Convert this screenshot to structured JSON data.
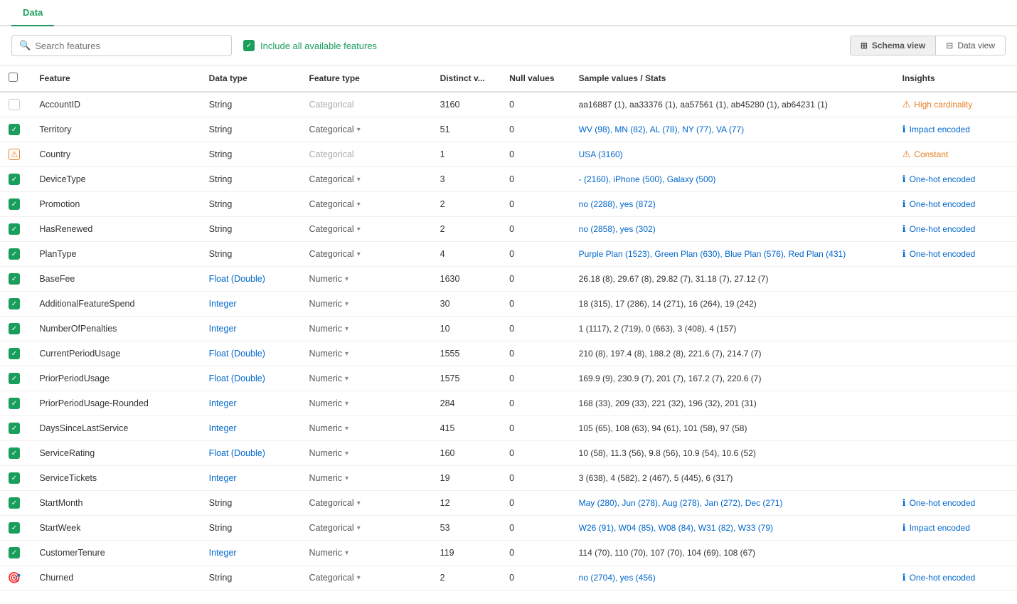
{
  "tabs": [
    {
      "label": "Data",
      "active": true
    }
  ],
  "toolbar": {
    "search_placeholder": "Search features",
    "include_label": "Include all available features",
    "schema_view_label": "Schema view",
    "data_view_label": "Data view"
  },
  "table": {
    "headers": [
      "",
      "Feature",
      "Data type",
      "Feature type",
      "Distinct v...",
      "Null values",
      "Sample values / Stats",
      "Insights"
    ],
    "rows": [
      {
        "check": "unchecked",
        "feature": "AccountID",
        "data_type": "String",
        "feature_type": "Categorical",
        "feature_type_muted": true,
        "distinct": "3160",
        "null": "0",
        "sample": "aa16887 (1), aa33376 (1), aa57561 (1), ab45280 (1), ab64231 (1)",
        "sample_type": "plain",
        "insight": "High cardinality",
        "insight_type": "warning"
      },
      {
        "check": "checked",
        "feature": "Territory",
        "data_type": "String",
        "feature_type": "Categorical",
        "has_chevron": true,
        "distinct": "51",
        "null": "0",
        "sample": "WV (98), MN (82), AL (78), NY (77), VA (77)",
        "sample_type": "link",
        "insight": "Impact encoded",
        "insight_type": "info"
      },
      {
        "check": "warning",
        "feature": "Country",
        "data_type": "String",
        "feature_type": "Categorical",
        "feature_type_muted": true,
        "distinct": "1",
        "null": "0",
        "sample": "USA (3160)",
        "sample_type": "link",
        "insight": "Constant",
        "insight_type": "warning"
      },
      {
        "check": "checked",
        "feature": "DeviceType",
        "data_type": "String",
        "feature_type": "Categorical",
        "has_chevron": true,
        "distinct": "3",
        "null": "0",
        "sample": "- (2160), iPhone (500), Galaxy (500)",
        "sample_type": "link",
        "insight": "One-hot encoded",
        "insight_type": "info"
      },
      {
        "check": "checked",
        "feature": "Promotion",
        "data_type": "String",
        "feature_type": "Categorical",
        "has_chevron": true,
        "distinct": "2",
        "null": "0",
        "sample": "no (2288), yes (872)",
        "sample_type": "link",
        "insight": "One-hot encoded",
        "insight_type": "info"
      },
      {
        "check": "checked",
        "feature": "HasRenewed",
        "data_type": "String",
        "feature_type": "Categorical",
        "has_chevron": true,
        "distinct": "2",
        "null": "0",
        "sample": "no (2858), yes (302)",
        "sample_type": "link",
        "insight": "One-hot encoded",
        "insight_type": "info"
      },
      {
        "check": "checked",
        "feature": "PlanType",
        "data_type": "String",
        "feature_type": "Categorical",
        "has_chevron": true,
        "distinct": "4",
        "null": "0",
        "sample": "Purple Plan (1523), Green Plan (630), Blue Plan (576), Red Plan (431)",
        "sample_type": "link",
        "insight": "One-hot encoded",
        "insight_type": "info"
      },
      {
        "check": "checked",
        "feature": "BaseFee",
        "data_type": "Float (Double)",
        "feature_type": "Numeric",
        "has_chevron": true,
        "distinct": "1630",
        "null": "0",
        "sample": "26.18 (8), 29.67 (8), 29.82 (7), 31.18 (7), 27.12 (7)",
        "sample_type": "plain",
        "insight": "",
        "insight_type": ""
      },
      {
        "check": "checked",
        "feature": "AdditionalFeatureSpend",
        "data_type": "Integer",
        "feature_type": "Numeric",
        "has_chevron": true,
        "distinct": "30",
        "null": "0",
        "sample": "18 (315), 17 (286), 14 (271), 16 (264), 19 (242)",
        "sample_type": "plain",
        "insight": "",
        "insight_type": ""
      },
      {
        "check": "checked",
        "feature": "NumberOfPenalties",
        "data_type": "Integer",
        "feature_type": "Numeric",
        "has_chevron": true,
        "distinct": "10",
        "null": "0",
        "sample": "1 (1117), 2 (719), 0 (663), 3 (408), 4 (157)",
        "sample_type": "plain",
        "insight": "",
        "insight_type": ""
      },
      {
        "check": "checked",
        "feature": "CurrentPeriodUsage",
        "data_type": "Float (Double)",
        "feature_type": "Numeric",
        "has_chevron": true,
        "distinct": "1555",
        "null": "0",
        "sample": "210 (8), 197.4 (8), 188.2 (8), 221.6 (7), 214.7 (7)",
        "sample_type": "plain",
        "insight": "",
        "insight_type": ""
      },
      {
        "check": "checked",
        "feature": "PriorPeriodUsage",
        "data_type": "Float (Double)",
        "feature_type": "Numeric",
        "has_chevron": true,
        "distinct": "1575",
        "null": "0",
        "sample": "169.9 (9), 230.9 (7), 201 (7), 167.2 (7), 220.6 (7)",
        "sample_type": "plain",
        "insight": "",
        "insight_type": ""
      },
      {
        "check": "checked",
        "feature": "PriorPeriodUsage-Rounded",
        "data_type": "Integer",
        "feature_type": "Numeric",
        "has_chevron": true,
        "distinct": "284",
        "null": "0",
        "sample": "168 (33), 209 (33), 221 (32), 196 (32), 201 (31)",
        "sample_type": "plain",
        "insight": "",
        "insight_type": ""
      },
      {
        "check": "checked",
        "feature": "DaysSinceLastService",
        "data_type": "Integer",
        "feature_type": "Numeric",
        "has_chevron": true,
        "distinct": "415",
        "null": "0",
        "sample": "105 (65), 108 (63), 94 (61), 101 (58), 97 (58)",
        "sample_type": "plain",
        "insight": "",
        "insight_type": ""
      },
      {
        "check": "checked",
        "feature": "ServiceRating",
        "data_type": "Float (Double)",
        "feature_type": "Numeric",
        "has_chevron": true,
        "distinct": "160",
        "null": "0",
        "sample": "10 (58), 11.3 (56), 9.8 (56), 10.9 (54), 10.6 (52)",
        "sample_type": "plain",
        "insight": "",
        "insight_type": ""
      },
      {
        "check": "checked",
        "feature": "ServiceTickets",
        "data_type": "Integer",
        "feature_type": "Numeric",
        "has_chevron": true,
        "distinct": "19",
        "null": "0",
        "sample": "3 (638), 4 (582), 2 (467), 5 (445), 6 (317)",
        "sample_type": "plain",
        "insight": "",
        "insight_type": ""
      },
      {
        "check": "checked",
        "feature": "StartMonth",
        "data_type": "String",
        "feature_type": "Categorical",
        "has_chevron": true,
        "distinct": "12",
        "null": "0",
        "sample": "May (280), Jun (278), Aug (278), Jan (272), Dec (271)",
        "sample_type": "link",
        "insight": "One-hot encoded",
        "insight_type": "info"
      },
      {
        "check": "checked",
        "feature": "StartWeek",
        "data_type": "String",
        "feature_type": "Categorical",
        "has_chevron": true,
        "distinct": "53",
        "null": "0",
        "sample": "W26 (91), W04 (85), W08 (84), W31 (82), W33 (79)",
        "sample_type": "link",
        "insight": "Impact encoded",
        "insight_type": "info"
      },
      {
        "check": "checked",
        "feature": "CustomerTenure",
        "data_type": "Integer",
        "feature_type": "Numeric",
        "has_chevron": true,
        "distinct": "119",
        "null": "0",
        "sample": "114 (70), 110 (70), 107 (70), 104 (69), 108 (67)",
        "sample_type": "plain",
        "insight": "",
        "insight_type": ""
      },
      {
        "check": "target",
        "feature": "Churned",
        "data_type": "String",
        "feature_type": "Categorical",
        "has_chevron": true,
        "distinct": "2",
        "null": "0",
        "sample": "no (2704), yes (456)",
        "sample_type": "link",
        "insight": "One-hot encoded",
        "insight_type": "info"
      }
    ]
  }
}
